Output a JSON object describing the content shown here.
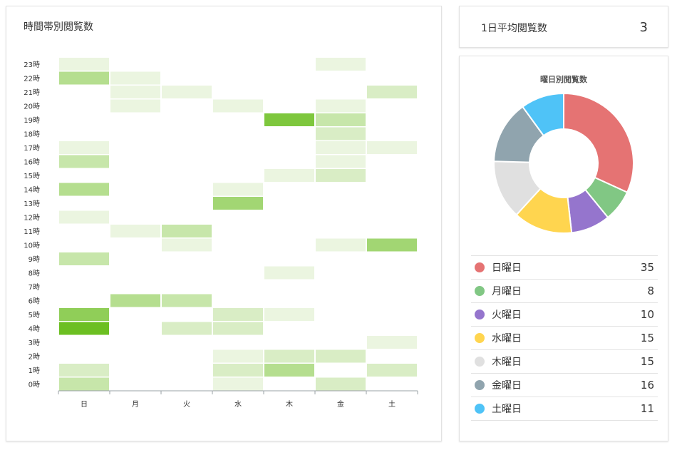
{
  "heatmap_panel": {
    "title": "時間帯別閲覧数"
  },
  "average_panel": {
    "label": "1日平均閲覧数",
    "value": "3"
  },
  "weekday_panel": {
    "title": "曜日別閲覧数"
  },
  "chart_data": [
    {
      "type": "heatmap",
      "title": "時間帯別閲覧数",
      "x": [
        "日",
        "月",
        "火",
        "水",
        "木",
        "金",
        "土"
      ],
      "y": [
        "0時",
        "1時",
        "2時",
        "3時",
        "4時",
        "5時",
        "6時",
        "7時",
        "8時",
        "9時",
        "10時",
        "11時",
        "12時",
        "13時",
        "14時",
        "15時",
        "16時",
        "17時",
        "18時",
        "19時",
        "20時",
        "21時",
        "22時",
        "23時"
      ],
      "max_value": 8,
      "color_low": "#ebf5e0",
      "color_high": "#6cbf22",
      "cells": [
        {
          "day": "日",
          "hour": "23時",
          "value": 1
        },
        {
          "day": "日",
          "hour": "22時",
          "value": 4
        },
        {
          "day": "日",
          "hour": "17時",
          "value": 1
        },
        {
          "day": "日",
          "hour": "16時",
          "value": 3
        },
        {
          "day": "日",
          "hour": "14時",
          "value": 4
        },
        {
          "day": "日",
          "hour": "12時",
          "value": 1
        },
        {
          "day": "日",
          "hour": "9時",
          "value": 3
        },
        {
          "day": "日",
          "hour": "5時",
          "value": 6
        },
        {
          "day": "日",
          "hour": "4時",
          "value": 8
        },
        {
          "day": "日",
          "hour": "1時",
          "value": 2
        },
        {
          "day": "日",
          "hour": "0時",
          "value": 3
        },
        {
          "day": "月",
          "hour": "22時",
          "value": 1
        },
        {
          "day": "月",
          "hour": "21時",
          "value": 1
        },
        {
          "day": "月",
          "hour": "20時",
          "value": 1
        },
        {
          "day": "月",
          "hour": "11時",
          "value": 1
        },
        {
          "day": "月",
          "hour": "6時",
          "value": 4
        },
        {
          "day": "火",
          "hour": "21時",
          "value": 1
        },
        {
          "day": "火",
          "hour": "11時",
          "value": 3
        },
        {
          "day": "火",
          "hour": "10時",
          "value": 1
        },
        {
          "day": "火",
          "hour": "6時",
          "value": 3
        },
        {
          "day": "火",
          "hour": "4時",
          "value": 2
        },
        {
          "day": "水",
          "hour": "20時",
          "value": 1
        },
        {
          "day": "水",
          "hour": "14時",
          "value": 1
        },
        {
          "day": "水",
          "hour": "13時",
          "value": 5
        },
        {
          "day": "水",
          "hour": "5時",
          "value": 2
        },
        {
          "day": "水",
          "hour": "4時",
          "value": 2
        },
        {
          "day": "水",
          "hour": "2時",
          "value": 1
        },
        {
          "day": "水",
          "hour": "1時",
          "value": 2
        },
        {
          "day": "水",
          "hour": "0時",
          "value": 1
        },
        {
          "day": "木",
          "hour": "19時",
          "value": 7
        },
        {
          "day": "木",
          "hour": "15時",
          "value": 1
        },
        {
          "day": "木",
          "hour": "8時",
          "value": 1
        },
        {
          "day": "木",
          "hour": "5時",
          "value": 1
        },
        {
          "day": "木",
          "hour": "2時",
          "value": 2
        },
        {
          "day": "木",
          "hour": "1時",
          "value": 4
        },
        {
          "day": "金",
          "hour": "23時",
          "value": 1
        },
        {
          "day": "金",
          "hour": "20時",
          "value": 1
        },
        {
          "day": "金",
          "hour": "19時",
          "value": 3
        },
        {
          "day": "金",
          "hour": "18時",
          "value": 2
        },
        {
          "day": "金",
          "hour": "17時",
          "value": 1
        },
        {
          "day": "金",
          "hour": "16時",
          "value": 1
        },
        {
          "day": "金",
          "hour": "15時",
          "value": 2
        },
        {
          "day": "金",
          "hour": "10時",
          "value": 1
        },
        {
          "day": "金",
          "hour": "2時",
          "value": 2
        },
        {
          "day": "金",
          "hour": "0時",
          "value": 2
        },
        {
          "day": "土",
          "hour": "21時",
          "value": 2
        },
        {
          "day": "土",
          "hour": "17時",
          "value": 1
        },
        {
          "day": "土",
          "hour": "10時",
          "value": 5
        },
        {
          "day": "土",
          "hour": "3時",
          "value": 1
        },
        {
          "day": "土",
          "hour": "1時",
          "value": 2
        }
      ]
    },
    {
      "type": "pie",
      "title": "曜日別閲覧数",
      "donut": true,
      "categories": [
        "日曜日",
        "月曜日",
        "火曜日",
        "水曜日",
        "木曜日",
        "金曜日",
        "土曜日"
      ],
      "values": [
        35,
        8,
        10,
        15,
        15,
        16,
        11
      ],
      "colors": [
        "#e57373",
        "#81c784",
        "#9575cd",
        "#ffd54f",
        "#e0e0e0",
        "#90a4ae",
        "#4fc3f7"
      ],
      "legend": "below"
    }
  ]
}
